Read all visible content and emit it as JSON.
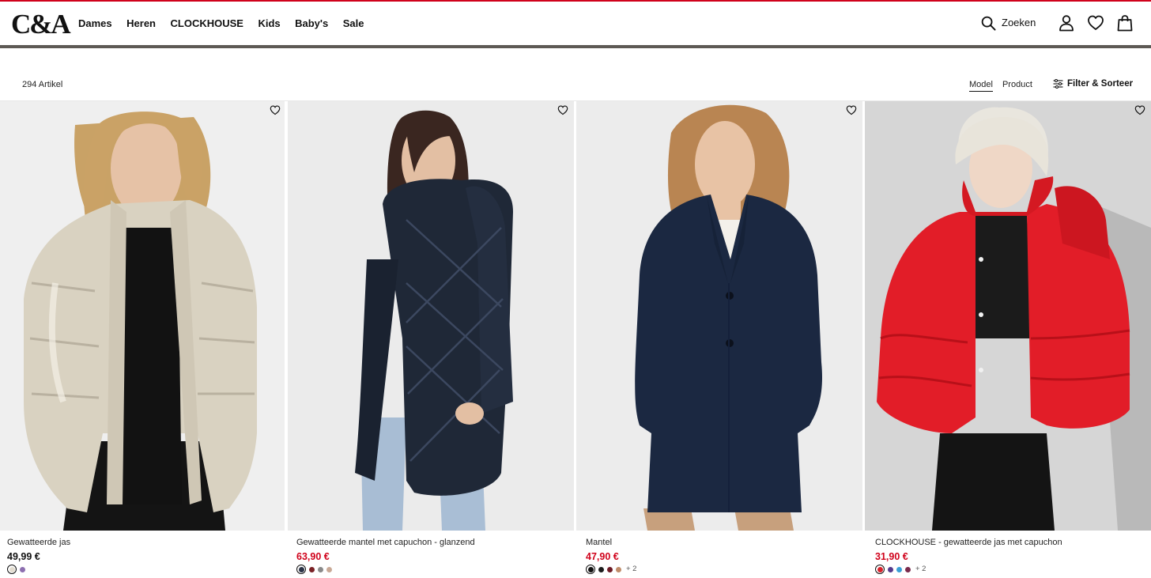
{
  "brand": {
    "logo_text": "C&A",
    "accent_color": "#d0021b"
  },
  "nav": {
    "items": [
      {
        "label": "Dames"
      },
      {
        "label": "Heren"
      },
      {
        "label": "CLOCKHOUSE"
      },
      {
        "label": "Kids"
      },
      {
        "label": "Baby's"
      },
      {
        "label": "Sale"
      }
    ]
  },
  "header": {
    "search_label": "Zoeken",
    "icons": [
      "search-icon",
      "account-icon",
      "wishlist-icon",
      "bag-icon"
    ]
  },
  "toolbar": {
    "count": "294 Artikel",
    "view_model": "Model",
    "view_product": "Product",
    "active_view": "Model",
    "filter_label": "Filter & Sorteer"
  },
  "products": [
    {
      "name": "Gewatteerde jas",
      "price": "49,99 €",
      "price_color": "#111111",
      "swatches": [
        "#e3ddd0",
        "#8d6fb0"
      ],
      "selected_swatch": 0,
      "more": ""
    },
    {
      "name": "Gewatteerde mantel met capuchon - glanzend",
      "price": "63,90 €",
      "price_color": "#d0021b",
      "swatches": [
        "#2b3347",
        "#7a2226",
        "#8a8a8a",
        "#c9a996"
      ],
      "selected_swatch": 0,
      "more": ""
    },
    {
      "name": "Mantel",
      "price": "47,90 €",
      "price_color": "#d0021b",
      "swatches": [
        "#111111",
        "#1c1c1c",
        "#6e1b26",
        "#c08c6a"
      ],
      "selected_swatch": 0,
      "more": "+ 2"
    },
    {
      "name": "CLOCKHOUSE - gewatteerde jas met capuchon",
      "price": "31,90 €",
      "price_color": "#d0021b",
      "swatches": [
        "#d9202a",
        "#553a8c",
        "#3aa0d6",
        "#7a2a4c"
      ],
      "selected_swatch": 0,
      "more": "+ 2"
    }
  ]
}
